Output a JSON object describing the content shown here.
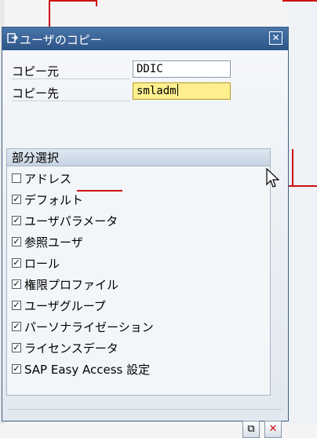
{
  "dialog": {
    "title": "ユーザのコピー",
    "close_symbol": "✕"
  },
  "fields": [
    {
      "label": "コピー元",
      "value": "DDIC"
    },
    {
      "label": "コピー先",
      "value": "smladm"
    }
  ],
  "group": {
    "title": "部分選択",
    "items": [
      {
        "label": "アドレス",
        "checked": false,
        "mark": ""
      },
      {
        "label": "デフォルト",
        "checked": true,
        "mark": "✓"
      },
      {
        "label": "ユーザパラメータ",
        "checked": true,
        "mark": "✓"
      },
      {
        "label": "参照ユーザ",
        "checked": true,
        "mark": "✓"
      },
      {
        "label": "ロール",
        "checked": true,
        "mark": "✓"
      },
      {
        "label": "権限プロファイル",
        "checked": true,
        "mark": "✓"
      },
      {
        "label": "ユーザグループ",
        "checked": true,
        "mark": "✓"
      },
      {
        "label": "パーソナライゼーション",
        "checked": true,
        "mark": "✓"
      },
      {
        "label": "ライセンスデータ",
        "checked": true,
        "mark": "✓"
      },
      {
        "label": "SAP Easy Access 設定",
        "checked": true,
        "mark": "✓"
      }
    ]
  },
  "footer": {
    "copy_symbol": "⧉",
    "cancel_symbol": "✕"
  },
  "colors": {
    "title_bar": "#2c5487",
    "active_field": "#ffef8f",
    "annotation_line": "#cc1010"
  },
  "icons": [
    "copy-dialog-icon",
    "close-icon",
    "checkbox-icon",
    "copy-icon",
    "cancel-icon",
    "mouse-cursor-icon"
  ]
}
